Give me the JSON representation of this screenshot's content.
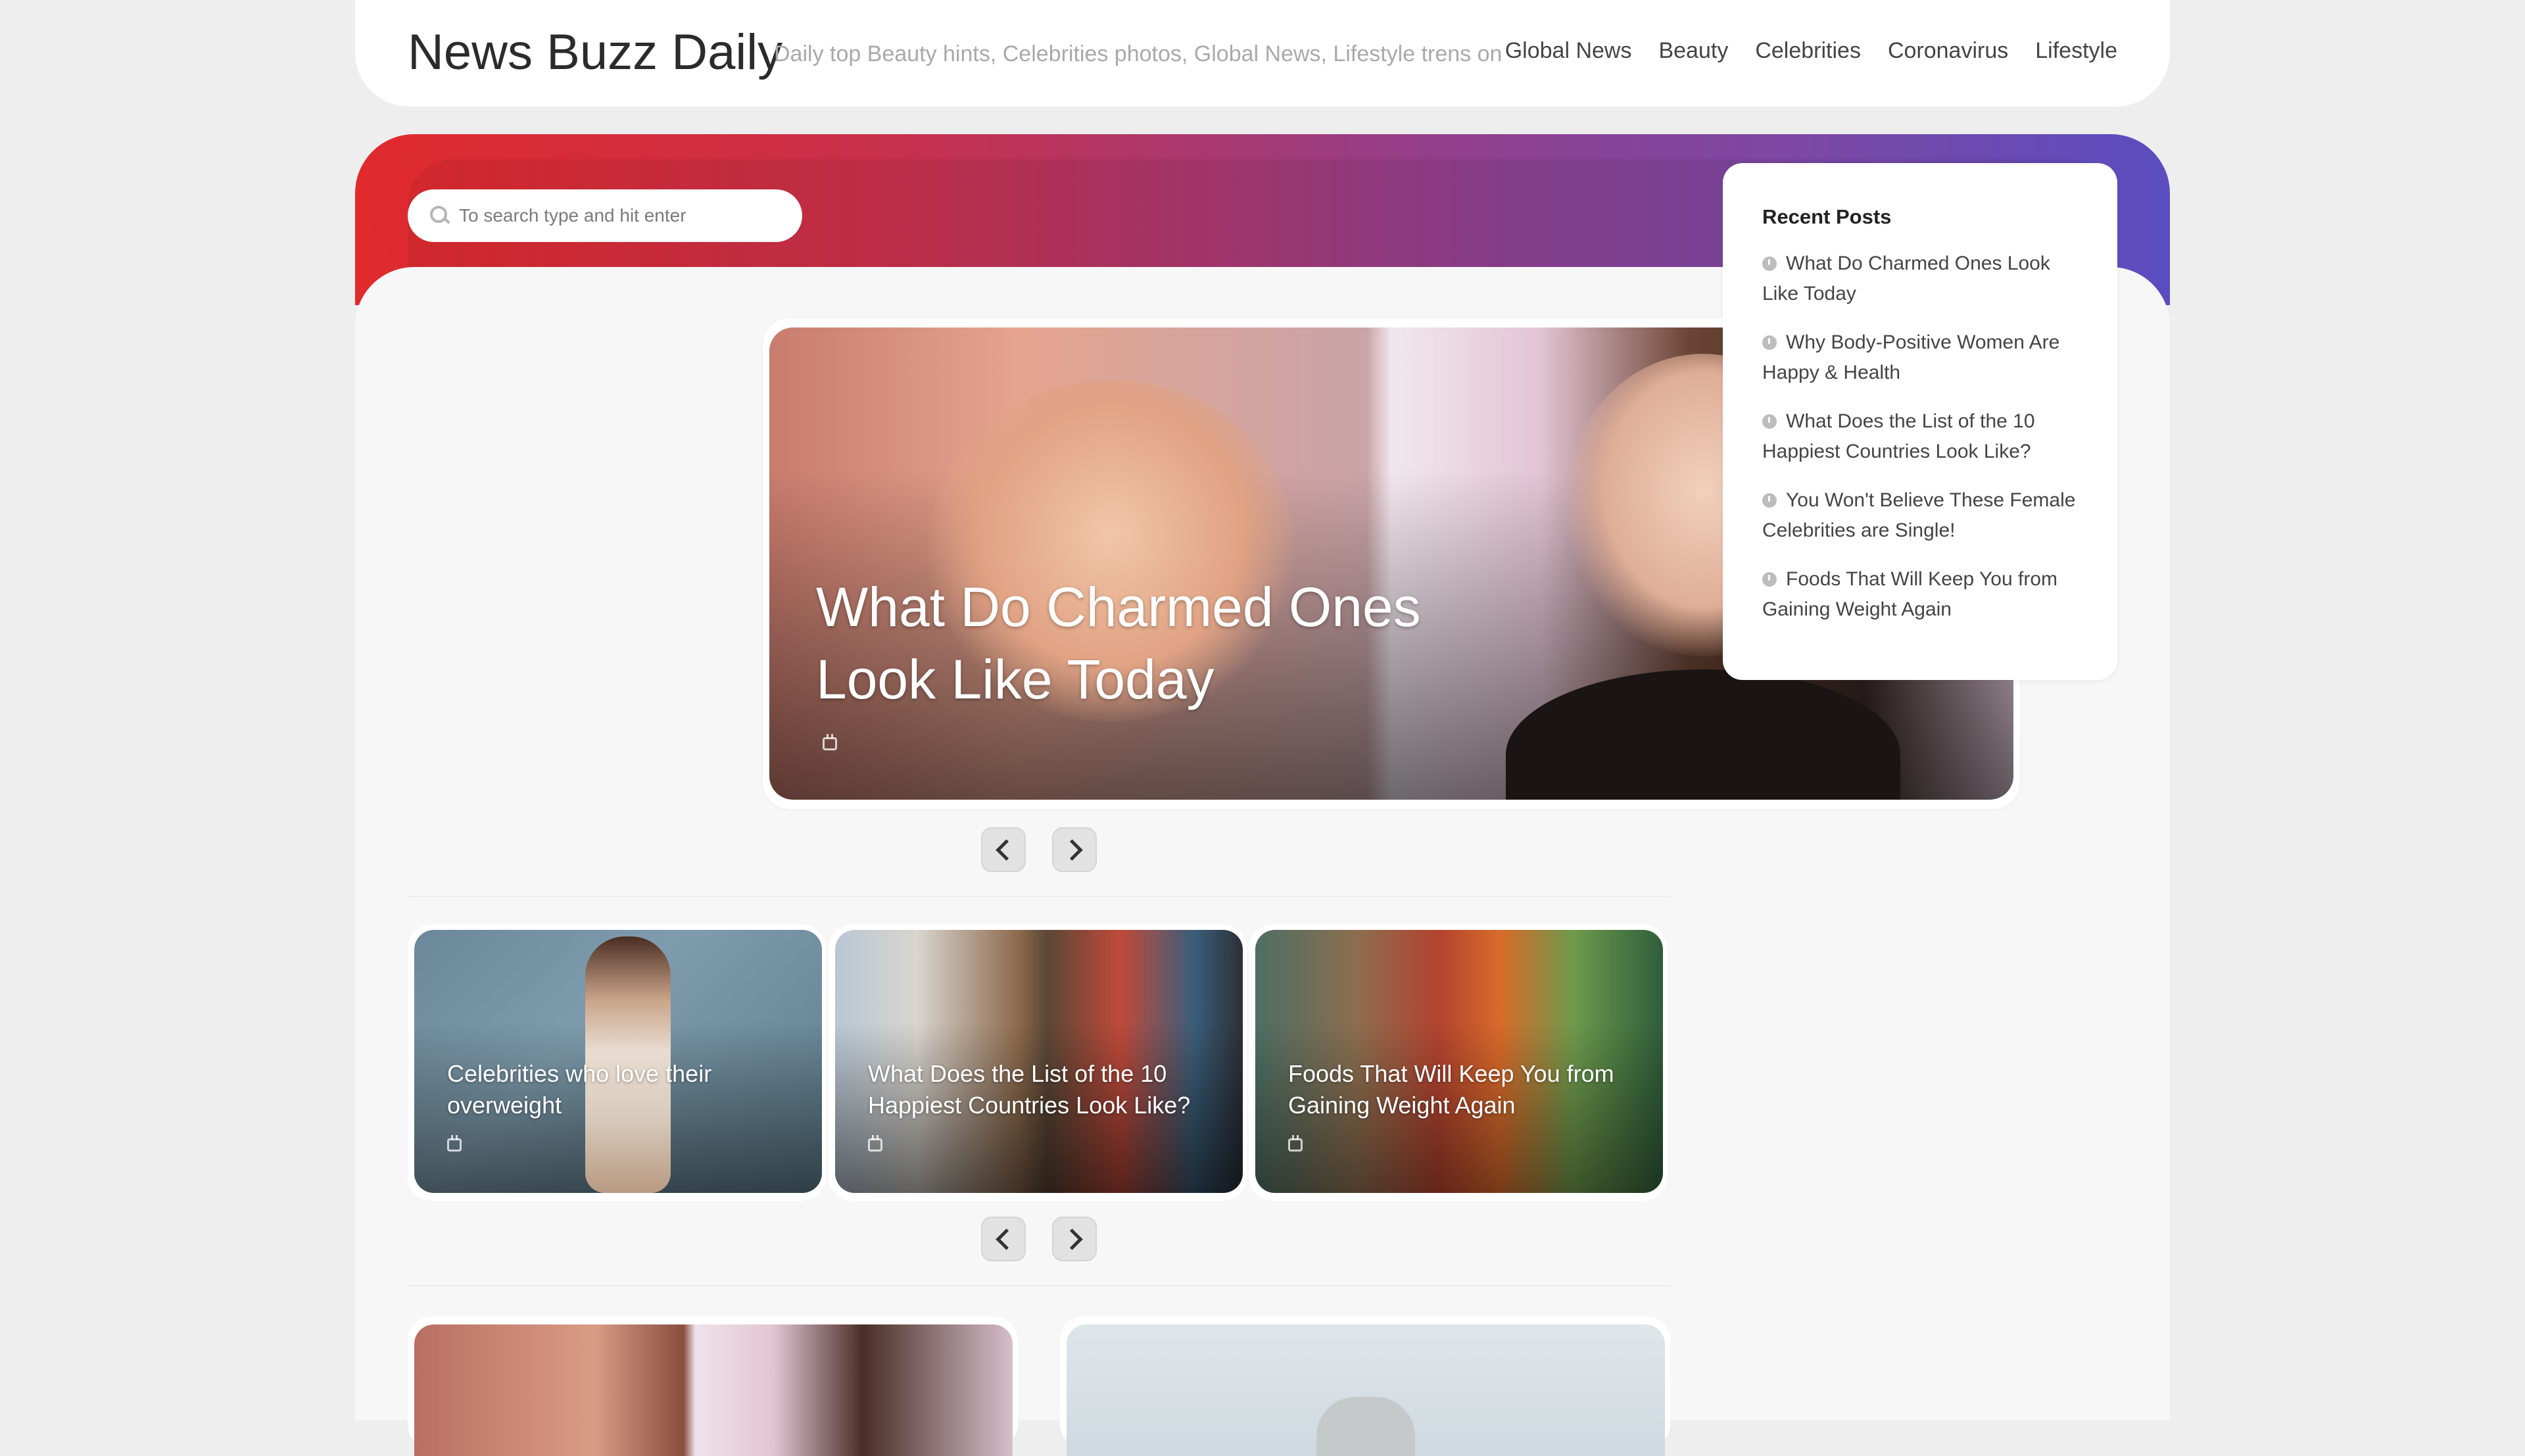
{
  "site": {
    "title": "News Buzz Daily",
    "tagline": "Daily top Beauty hints, Celebrities photos, Global News, Lifestyle trens on"
  },
  "nav": {
    "items": [
      {
        "label": "Global News"
      },
      {
        "label": "Beauty"
      },
      {
        "label": "Celebrities"
      },
      {
        "label": "Coronavirus"
      },
      {
        "label": "Lifestyle"
      }
    ]
  },
  "search": {
    "placeholder": "To search type and hit enter",
    "icon": "search-icon"
  },
  "featured": {
    "title": "What Do Charmed Ones Look Like Today",
    "date_icon": "calendar-icon"
  },
  "cards": [
    {
      "title": "Celebrities who love their overweight"
    },
    {
      "title": "What Does the List of the 10 Happiest Countries Look Like?"
    },
    {
      "title": "Foods That Will Keep You from Gaining Weight Again"
    }
  ],
  "sidebar": {
    "heading": "Recent Posts",
    "posts": [
      {
        "label": "What Do Charmed Ones Look Like Today"
      },
      {
        "label": "Why Body-Positive Women Are Happy & Health"
      },
      {
        "label": "What Does the List of the 10 Happiest Countries Look Like?"
      },
      {
        "label": "You Won't Believe These Female Celebrities are Single!"
      },
      {
        "label": "Foods That Will Keep You from Gaining Weight Again"
      }
    ]
  },
  "theme": {
    "gradient_start": "#e02a2c",
    "gradient_mid": "#8f4090",
    "gradient_end": "#5b4dc0",
    "background": "#eeeeee"
  }
}
